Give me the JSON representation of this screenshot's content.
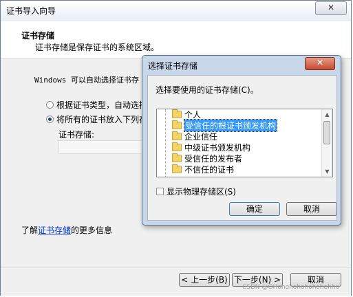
{
  "wizard": {
    "title": "证书导入向导",
    "close_label": "✕",
    "header_title": "证书存储",
    "header_subtitle": "证书存储是保存证书的系统区域。",
    "intro_text": "Windows 可以自动选择证书存",
    "radio_auto_label": "根据证书类型，自动选择",
    "radio_manual_label": "将所有的证书放入下列存",
    "store_label": "证书存储:",
    "store_value": "",
    "learn_prefix": "了解",
    "learn_link": "证书存储",
    "learn_suffix": "的更多信息",
    "back_button": "< 上一步(B)",
    "next_button": "下一步(N) >",
    "cancel_button": "取消",
    "selected_radio": "manual"
  },
  "dialog": {
    "title": "选择证书存储",
    "close_label": "✕",
    "prompt": "选择要使用的证书存储(C)。",
    "items": [
      {
        "label": "个人",
        "selected": false
      },
      {
        "label": "受信任的根证书颁发机构",
        "selected": true
      },
      {
        "label": "企业信任",
        "selected": false
      },
      {
        "label": "中级证书颁发机构",
        "selected": false
      },
      {
        "label": "受信任的发布者",
        "selected": false
      },
      {
        "label": "不信任的证书",
        "selected": false
      }
    ],
    "show_physical_label": "显示物理存储区(S)",
    "show_physical_checked": false,
    "ok_button": "确定",
    "cancel_button": "取消"
  },
  "watermark": "CSDN @OHohohohohohohohho",
  "colors": {
    "selection": "#3399ff",
    "link": "#0033cc",
    "dialog_frame": "#c8d7ea",
    "close_red": "#c74b33"
  },
  "icons": {
    "folder": "folder-icon",
    "close": "close-icon",
    "scroll_up": "scroll-up-icon",
    "scroll_down": "scroll-down-icon"
  }
}
